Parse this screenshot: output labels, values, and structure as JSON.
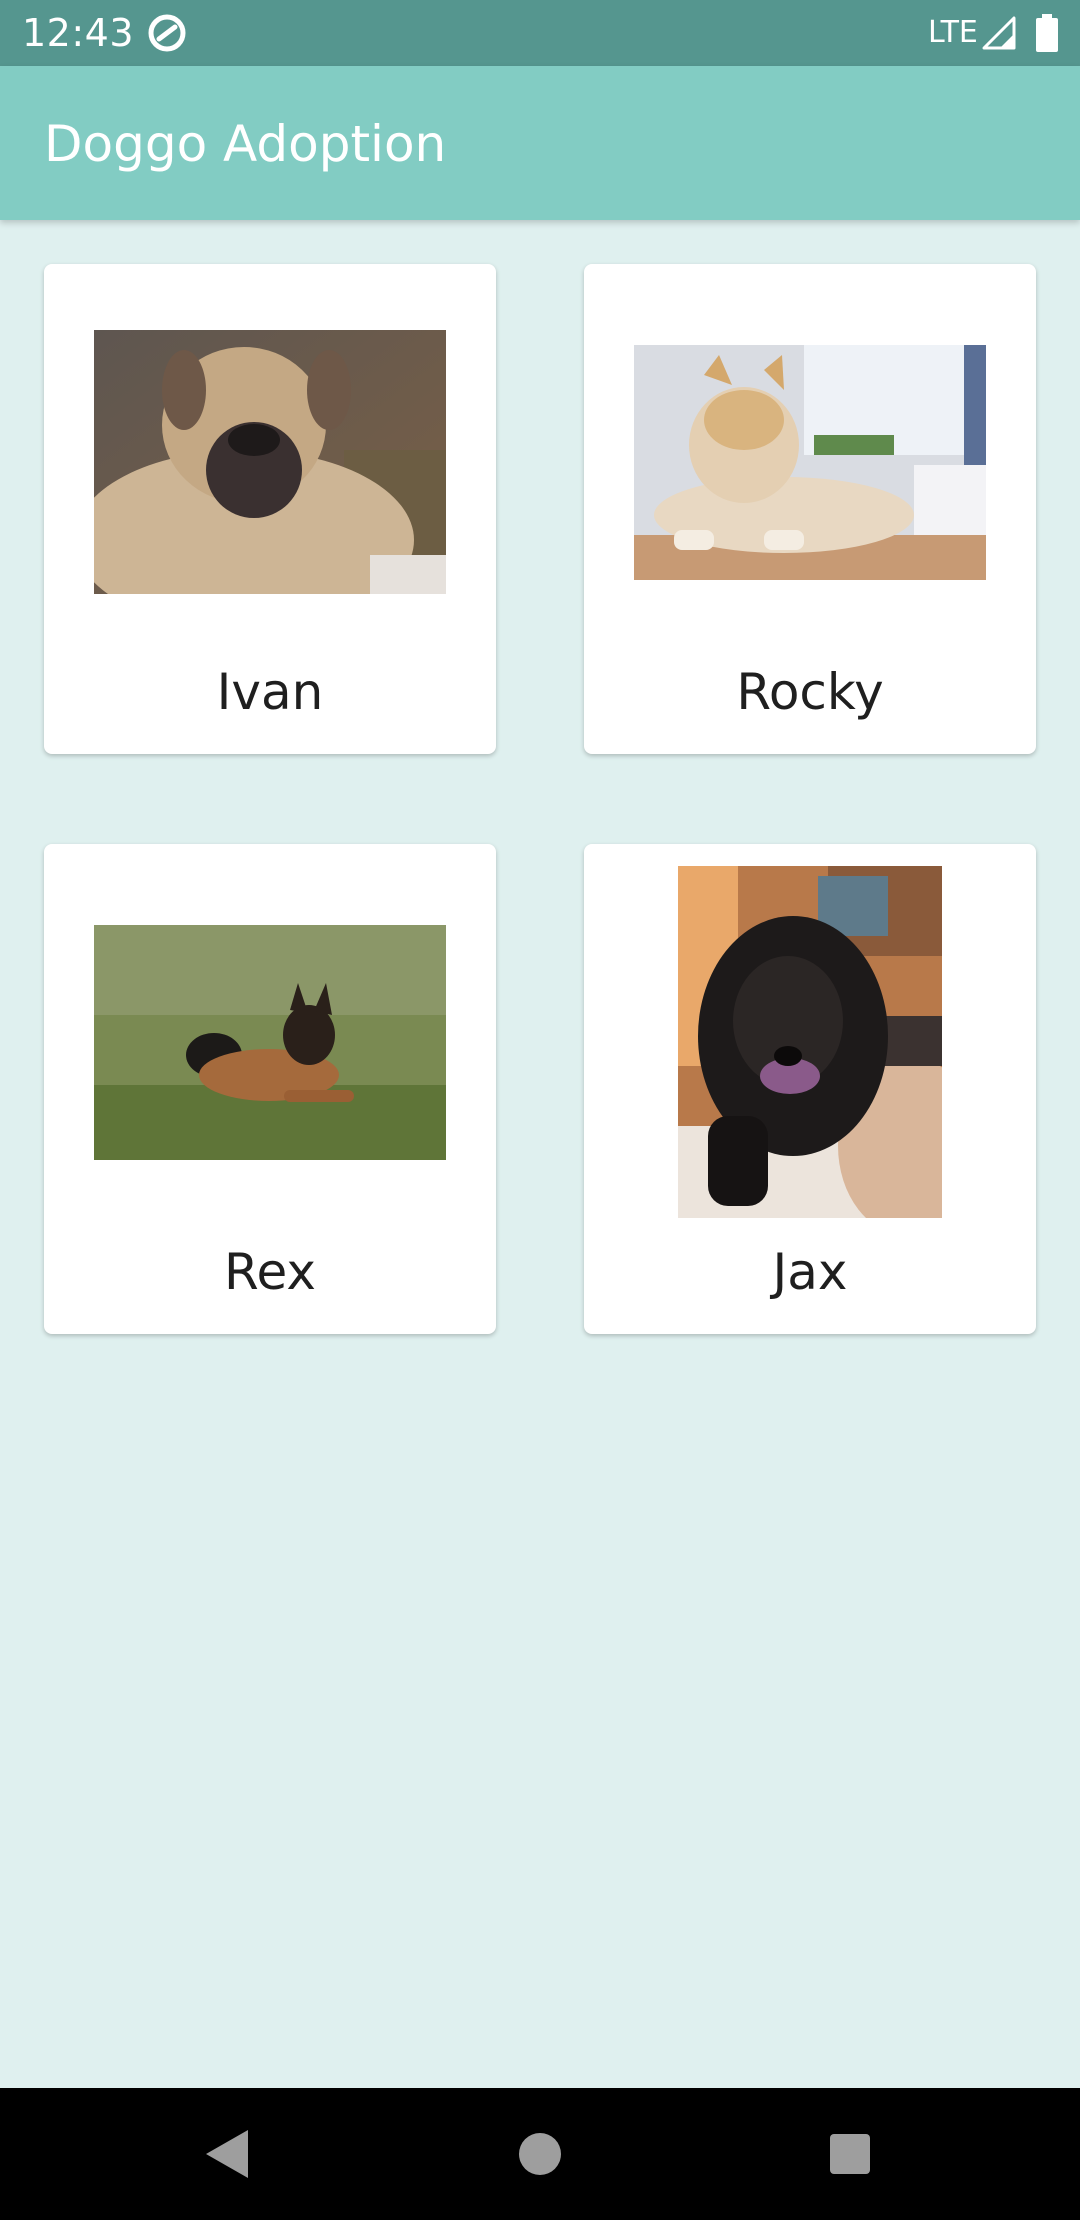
{
  "status_bar": {
    "time": "12:43",
    "network": "LTE",
    "icons": [
      "sync-icon",
      "signal-icon",
      "battery-icon"
    ],
    "background": "#55968f"
  },
  "app_bar": {
    "title": "Doggo Adoption",
    "background": "#82ccc3"
  },
  "page": {
    "background": "#dff0ef"
  },
  "dogs": [
    {
      "name": "Ivan",
      "photo_desc": "fawn mastiff"
    },
    {
      "name": "Rocky",
      "photo_desc": "akita lying on floor"
    },
    {
      "name": "Rex",
      "photo_desc": "shepherd puppy on grass"
    },
    {
      "name": "Jax",
      "photo_desc": "black curly spaniel"
    }
  ],
  "nav_bar": {
    "buttons": [
      "back-icon",
      "home-icon",
      "recents-icon"
    ]
  }
}
